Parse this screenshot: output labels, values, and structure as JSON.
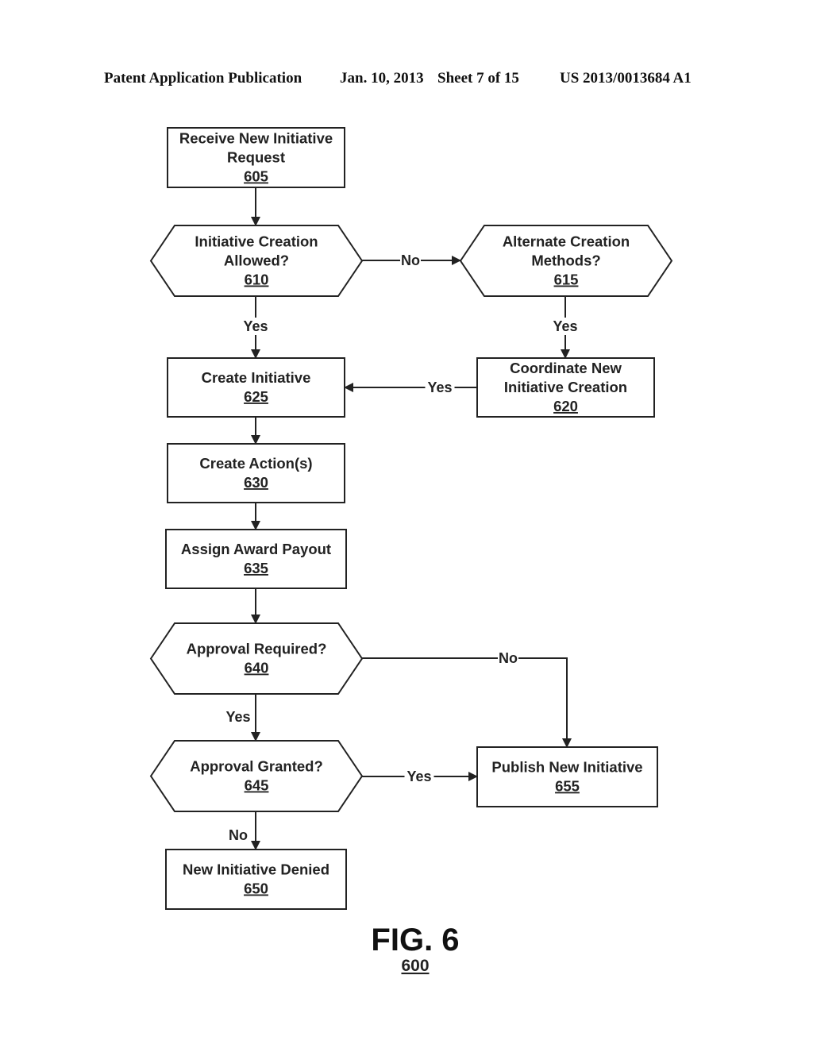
{
  "header": {
    "publication": "Patent Application Publication",
    "date": "Jan. 10, 2013",
    "sheet": "Sheet 7 of 15",
    "number": "US 2013/0013684 A1"
  },
  "figure": {
    "title": "FIG. 6",
    "number": "600"
  },
  "nodes": [
    {
      "id": "605",
      "type": "process",
      "lines": [
        "Receive New Initiative",
        "Request"
      ],
      "ref": "605"
    },
    {
      "id": "610",
      "type": "decision",
      "lines": [
        "Initiative Creation",
        "Allowed?"
      ],
      "ref": "610"
    },
    {
      "id": "615",
      "type": "decision",
      "lines": [
        "Alternate Creation",
        "Methods?"
      ],
      "ref": "615"
    },
    {
      "id": "620",
      "type": "process",
      "lines": [
        "Coordinate New",
        "Initiative Creation"
      ],
      "ref": "620"
    },
    {
      "id": "625",
      "type": "process",
      "lines": [
        "Create Initiative"
      ],
      "ref": "625"
    },
    {
      "id": "630",
      "type": "process",
      "lines": [
        "Create Action(s)"
      ],
      "ref": "630"
    },
    {
      "id": "635",
      "type": "process",
      "lines": [
        "Assign Award Payout"
      ],
      "ref": "635"
    },
    {
      "id": "640",
      "type": "decision",
      "lines": [
        "Approval Required?"
      ],
      "ref": "640"
    },
    {
      "id": "645",
      "type": "decision",
      "lines": [
        "Approval Granted?"
      ],
      "ref": "645"
    },
    {
      "id": "650",
      "type": "process",
      "lines": [
        "New Initiative Denied"
      ],
      "ref": "650"
    },
    {
      "id": "655",
      "type": "process",
      "lines": [
        "Publish New Initiative"
      ],
      "ref": "655"
    }
  ],
  "edges": [
    {
      "from": "605",
      "to": "610",
      "label": ""
    },
    {
      "from": "610",
      "to": "615",
      "label": "No"
    },
    {
      "from": "610",
      "to": "625",
      "label": "Yes"
    },
    {
      "from": "615",
      "to": "620",
      "label": "Yes"
    },
    {
      "from": "620",
      "to": "625",
      "label": "Yes"
    },
    {
      "from": "625",
      "to": "630",
      "label": ""
    },
    {
      "from": "630",
      "to": "635",
      "label": ""
    },
    {
      "from": "635",
      "to": "640",
      "label": ""
    },
    {
      "from": "640",
      "to": "655",
      "label": "No"
    },
    {
      "from": "640",
      "to": "645",
      "label": "Yes"
    },
    {
      "from": "645",
      "to": "655",
      "label": "Yes"
    },
    {
      "from": "645",
      "to": "650",
      "label": "No"
    }
  ]
}
